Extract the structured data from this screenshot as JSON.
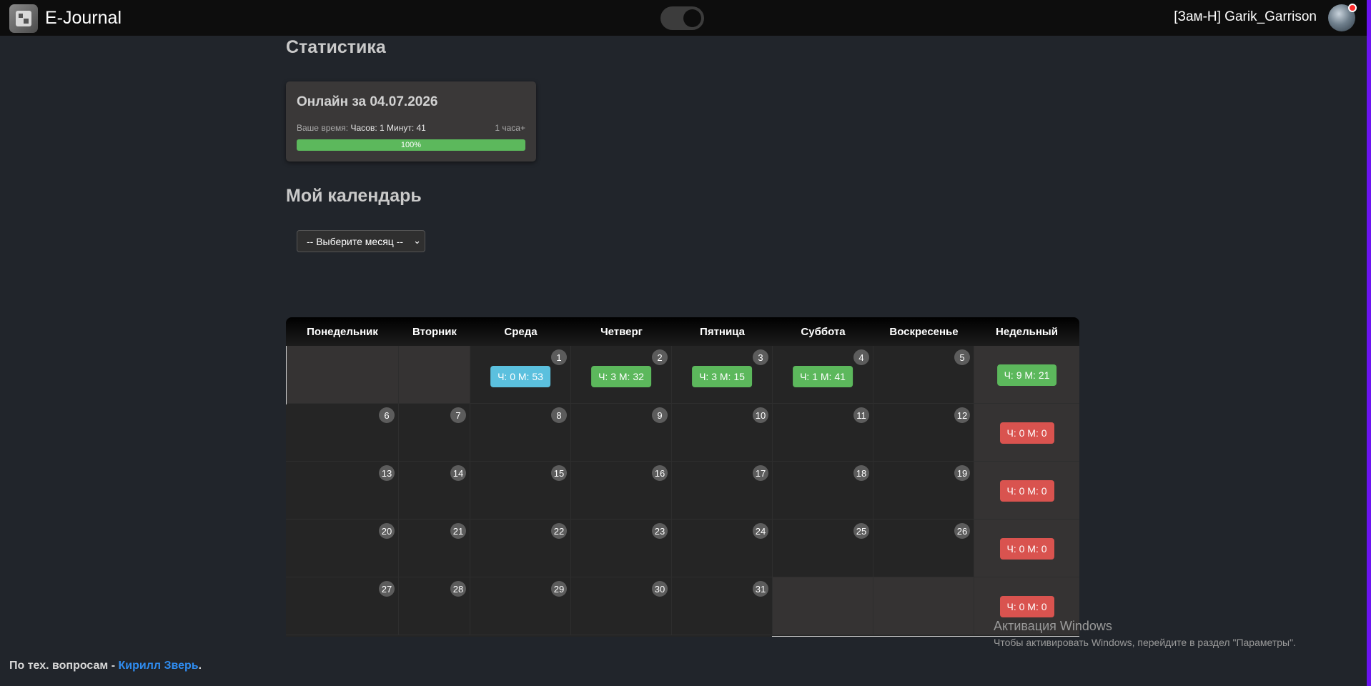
{
  "navbar": {
    "brand": "E-Journal",
    "user": "[Зам-Н] Garik_Garrison"
  },
  "stats": {
    "heading": "Статистика",
    "card_title": "Онлайн за 04.07.2026",
    "time_label": "Ваше время:",
    "time_value": "Часов: 1 Минут: 41",
    "goal": "1 часа+",
    "progress_text": "100%",
    "progress_percent": 100
  },
  "calendar_section": {
    "heading": "Мой календарь",
    "month_select": "-- Выберите месяц --"
  },
  "calendar": {
    "headers": [
      "Понедельник",
      "Вторник",
      "Среда",
      "Четверг",
      "Пятница",
      "Суббота",
      "Воскресенье",
      "Недельный"
    ],
    "weeks": [
      {
        "days": [
          null,
          null,
          "1",
          "2",
          "3",
          "4",
          "5"
        ],
        "badges": [
          null,
          null,
          "Ч: 0 М: 53",
          "Ч: 3 М: 32",
          "Ч: 3 М: 15",
          "Ч: 1 М: 41",
          null
        ],
        "badge_colors": [
          null,
          null,
          "blue",
          "green",
          "green",
          "green",
          null
        ],
        "weekly": "Ч: 9 М: 21",
        "weekly_color": "green"
      },
      {
        "days": [
          "6",
          "7",
          "8",
          "9",
          "10",
          "11",
          "12"
        ],
        "badges": [
          null,
          null,
          null,
          null,
          null,
          null,
          null
        ],
        "badge_colors": [
          null,
          null,
          null,
          null,
          null,
          null,
          null
        ],
        "weekly": "Ч: 0 М: 0",
        "weekly_color": "red"
      },
      {
        "days": [
          "13",
          "14",
          "15",
          "16",
          "17",
          "18",
          "19"
        ],
        "badges": [
          null,
          null,
          null,
          null,
          null,
          null,
          null
        ],
        "badge_colors": [
          null,
          null,
          null,
          null,
          null,
          null,
          null
        ],
        "weekly": "Ч: 0 М: 0",
        "weekly_color": "red"
      },
      {
        "days": [
          "20",
          "21",
          "22",
          "23",
          "24",
          "25",
          "26"
        ],
        "badges": [
          null,
          null,
          null,
          null,
          null,
          null,
          null
        ],
        "badge_colors": [
          null,
          null,
          null,
          null,
          null,
          null,
          null
        ],
        "weekly": "Ч: 0 М: 0",
        "weekly_color": "red"
      },
      {
        "days": [
          "27",
          "28",
          "29",
          "30",
          "31",
          null,
          null
        ],
        "badges": [
          null,
          null,
          null,
          null,
          null,
          null,
          null
        ],
        "badge_colors": [
          null,
          null,
          null,
          null,
          null,
          null,
          null
        ],
        "weekly": "Ч: 0 М: 0",
        "weekly_color": "red"
      }
    ]
  },
  "footer": {
    "prefix": "По тех. вопросам - ",
    "link": "Кирилл Зверь",
    "suffix": "."
  },
  "watermark": {
    "title": "Активация Windows",
    "text": "Чтобы активировать Windows, перейдите в раздел \"Параметры\"."
  },
  "colors": {
    "blue": "#5bc0de",
    "green": "#5cb85c",
    "red": "#d9534f",
    "link": "#2f8cf0",
    "scroll_accent": "#6b13f2"
  }
}
